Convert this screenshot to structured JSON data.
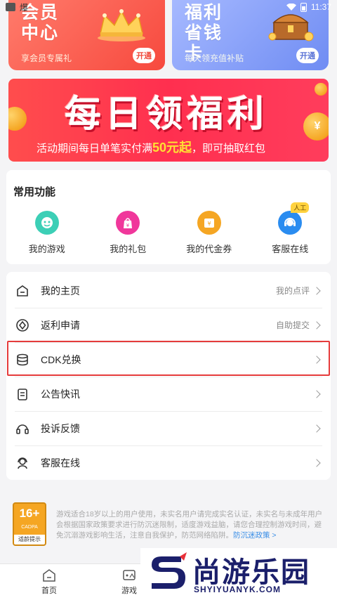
{
  "status_bar": {
    "app_glyph": "爆",
    "time": "11:37"
  },
  "promos": {
    "vip": {
      "title": "会员中心",
      "subtitle": "享会员专属礼",
      "button": "开通"
    },
    "save_card": {
      "title": "福利省钱卡",
      "subtitle": "每天领充值补贴",
      "button": "开通"
    }
  },
  "banner": {
    "title": "每日领福利",
    "subtitle_pre": "活动期间每日单笔实付满",
    "subtitle_highlight": "50元起",
    "subtitle_post": "，即可抽取红包",
    "coin_symbol": "¥"
  },
  "functions": {
    "title": "常用功能",
    "items": [
      {
        "label": "我的游戏",
        "icon": "game-face-icon",
        "color": "#3ccfb6"
      },
      {
        "label": "我的礼包",
        "icon": "gift-bag-icon",
        "color": "#f0379b"
      },
      {
        "label": "我的代金券",
        "icon": "voucher-icon",
        "color": "#f5a623"
      },
      {
        "label": "客服在线",
        "icon": "headset-icon",
        "color": "#2a8cf0",
        "badge": "人工"
      }
    ]
  },
  "menu": {
    "rows": [
      {
        "label": "我的主页",
        "right": "我的点评",
        "icon": "home-icon"
      },
      {
        "label": "返利申请",
        "right": "自助提交",
        "icon": "rebate-icon"
      },
      {
        "label": "CDK兑换",
        "right": "",
        "icon": "database-icon"
      },
      {
        "label": "公告快讯",
        "right": "",
        "icon": "clipboard-icon"
      },
      {
        "label": "投诉反馈",
        "right": "",
        "icon": "headphones-icon"
      },
      {
        "label": "客服在线",
        "right": "",
        "icon": "support-agent-icon"
      }
    ]
  },
  "notice": {
    "age_number": "16+",
    "age_org": "CADPA",
    "age_caption": "适龄提示",
    "text": "游戏适合18岁以上的用户使用，未实名用户请完成实名认证，未实名与未成年用户会根据国家政策要求进行防沉迷限制，适度游戏益脑，请您合理控制游戏时间，避免沉溺游戏影响生活，注意自我保护，防范网络陷阱。",
    "link": "防沉迷政策 >"
  },
  "bottom_nav": [
    {
      "label": "首页",
      "icon": "home-tab-icon"
    },
    {
      "label": "游戏",
      "icon": "gamepad-tab-icon"
    }
  ],
  "watermark": {
    "title": "尚游乐园",
    "url": "SHYIYUANYK.COM"
  }
}
